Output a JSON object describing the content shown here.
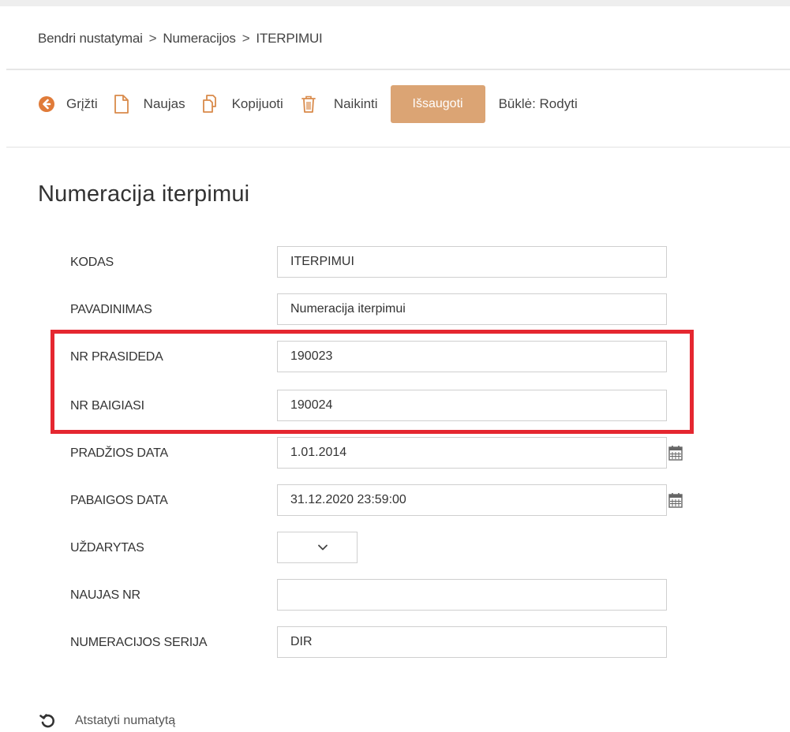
{
  "breadcrumb": {
    "items": [
      "Bendri nustatymai",
      "Numeracijos",
      "ITERPIMUI"
    ],
    "separator": ">"
  },
  "toolbar": {
    "back_label": "Grįžti",
    "new_label": "Naujas",
    "copy_label": "Kopijuoti",
    "delete_label": "Naikinti",
    "save_label": "Išsaugoti",
    "status_label": "Būklė: Rodyti"
  },
  "page": {
    "title": "Numeracija iterpimui"
  },
  "form": {
    "kodas": {
      "label": "KODAS",
      "value": "ITERPIMUI"
    },
    "pavadinimas": {
      "label": "PAVADINIMAS",
      "value": "Numeracija iterpimui"
    },
    "nr_prasideda": {
      "label": "NR PRASIDEDA",
      "value": "190023"
    },
    "nr_baigiasi": {
      "label": "NR BAIGIASI",
      "value": "190024"
    },
    "pradzios_data": {
      "label": "PRADŽIOS DATA",
      "value": "1.01.2014"
    },
    "pabaigos_data": {
      "label": "PABAIGOS DATA",
      "value": "31.12.2020 23:59:00"
    },
    "uzdarytas": {
      "label": "UŽDARYTAS",
      "value": ""
    },
    "naujas_nr": {
      "label": "NAUJAS NR",
      "value": ""
    },
    "numeracijos_serija": {
      "label": "NUMERACIJOS SERIJA",
      "value": "DIR"
    }
  },
  "footer": {
    "reset_label": "Atstatyti numatytą"
  },
  "colors": {
    "accent": "#dba474",
    "highlight": "#e52730",
    "back_icon": "#e07b39"
  },
  "icons": {
    "back": "back-arrow-icon",
    "new": "new-document-icon",
    "copy": "copy-icon",
    "delete": "trash-icon",
    "calendar": "calendar-icon",
    "dropdown": "chevron-down-icon",
    "reset": "reset-icon"
  }
}
